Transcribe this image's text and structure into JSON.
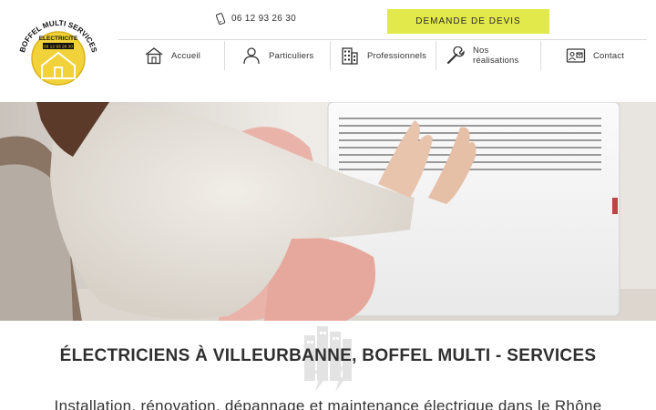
{
  "brand": {
    "logo_name": "BOFFEL MULTI SERVICES",
    "logo_tagline": "ELECTRICITE",
    "logo_phone": "06 12 93 26 30"
  },
  "header": {
    "phone": "06 12 93 26 30",
    "quote_button": "DEMANDE DE DEVIS"
  },
  "nav": {
    "items": [
      {
        "label": "Accueil",
        "icon": "home-icon"
      },
      {
        "label": "Particuliers",
        "icon": "person-icon"
      },
      {
        "label": "Professionnels",
        "icon": "building-icon"
      },
      {
        "label": "Nos réalisations",
        "icon": "wrench-icon"
      },
      {
        "label": "Contact",
        "icon": "contact-card-icon"
      }
    ]
  },
  "main": {
    "headline": "ÉLECTRICIENS À VILLEURBANNE, BOFFEL MULTI - SERVICES",
    "subline": "Installation, rénovation, dépannage et maintenance électrique dans le Rhône"
  },
  "colors": {
    "accent": "#e2e94a",
    "logo_gold": "#d9b21c",
    "text": "#2f2f2f"
  }
}
